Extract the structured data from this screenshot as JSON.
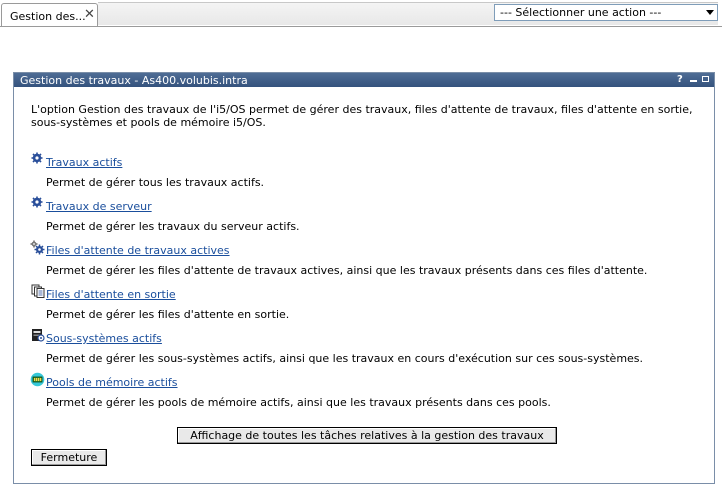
{
  "tab": {
    "label": "Gestion des...",
    "close_symbol": "✕"
  },
  "action_select": {
    "selected": "--- Sélectionner une action ---"
  },
  "portlet": {
    "title": "Gestion des travaux - As400.volubis.intra",
    "help_label": "?",
    "intro": "L'option Gestion des travaux de l'i5/OS permet de gérer des travaux, files d'attente de travaux, files d'attente en sortie, sous-systèmes et pools de mémoire i5/OS.",
    "tasks": [
      {
        "icon": "gear-icon",
        "link": "Travaux actifs",
        "desc": "Permet de gérer tous les travaux actifs."
      },
      {
        "icon": "gear-icon",
        "link": "Travaux de serveur",
        "desc": "Permet de gérer les travaux du serveur actifs."
      },
      {
        "icon": "gears-icon",
        "link": "Files d'attente de travaux actives",
        "desc": "Permet de gérer les files d'attente de travaux actives, ainsi que les travaux présents dans ces files d'attente."
      },
      {
        "icon": "pages-icon",
        "link": "Files d'attente en sortie",
        "desc": "Permet de gérer les files d'attente en sortie."
      },
      {
        "icon": "server-icon",
        "link": "Sous-systèmes actifs",
        "desc": "Permet de gérer les sous-systèmes actifs, ainsi que les travaux en cours d'exécution sur ces sous-systèmes."
      },
      {
        "icon": "memory-icon",
        "link": "Pools de mémoire actifs",
        "desc": "Permet de gérer les pools de mémoire actifs, ainsi que les travaux présents dans ces pools."
      }
    ],
    "all_tasks_button": "Affichage de toutes les tâches relatives à la gestion des travaux",
    "close_button": "Fermeture"
  },
  "colors": {
    "header": "#3f5d88",
    "link": "#1a4e9c"
  }
}
